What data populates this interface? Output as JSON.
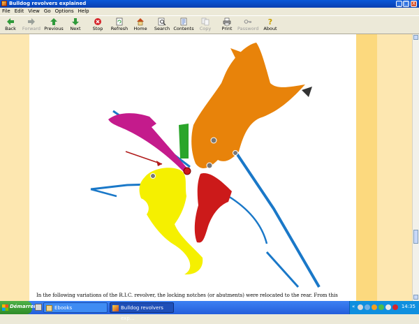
{
  "window": {
    "title": "Bulldog revolvers explained",
    "controls": [
      "_",
      "□",
      "X"
    ]
  },
  "menu": [
    "File",
    "Edit",
    "View",
    "Go",
    "Options",
    "Help"
  ],
  "toolbar": [
    {
      "label": "Back",
      "icon": "back-arrow-icon",
      "enabled": true
    },
    {
      "label": "Forward",
      "icon": "forward-arrow-icon",
      "enabled": false
    },
    {
      "label": "Previous",
      "icon": "up-arrow-icon",
      "enabled": true
    },
    {
      "label": "Next",
      "icon": "down-arrow-icon",
      "enabled": true
    },
    {
      "label": "Stop",
      "icon": "stop-icon",
      "enabled": true
    },
    {
      "label": "Refresh",
      "icon": "refresh-icon",
      "enabled": true
    },
    {
      "label": "Home",
      "icon": "home-icon",
      "enabled": true
    },
    {
      "label": "Search",
      "icon": "search-icon",
      "enabled": true
    },
    {
      "label": "Contents",
      "icon": "contents-icon",
      "enabled": true
    },
    {
      "label": "Copy",
      "icon": "copy-icon",
      "enabled": false
    },
    {
      "label": "Print",
      "icon": "print-icon",
      "enabled": true
    },
    {
      "label": "Password",
      "icon": "key-icon",
      "enabled": false
    },
    {
      "label": "About",
      "icon": "about-icon",
      "enabled": true
    }
  ],
  "content": {
    "body_text": "In the following variations of the R.I.C. revolver, the locking notches (or abutments) were relocated to the rear. From this"
  },
  "taskbar": {
    "start_label": "Démarrer",
    "tasks": [
      {
        "label": "Ebooks",
        "active": false
      },
      {
        "label": "Bulldog revolvers exp...",
        "active": true
      }
    ],
    "clock": "14:35",
    "tray_chevron": "«"
  },
  "colors": {
    "page_bg": "#fde7b0",
    "band": "#fcd97e",
    "hammer": "#e8830a",
    "trigger": "#f5f000",
    "pawl": "#cc1a1a",
    "cylinder_stop": "#c41b8c",
    "spring": "#1a78c8",
    "link": "#2aa52a"
  }
}
